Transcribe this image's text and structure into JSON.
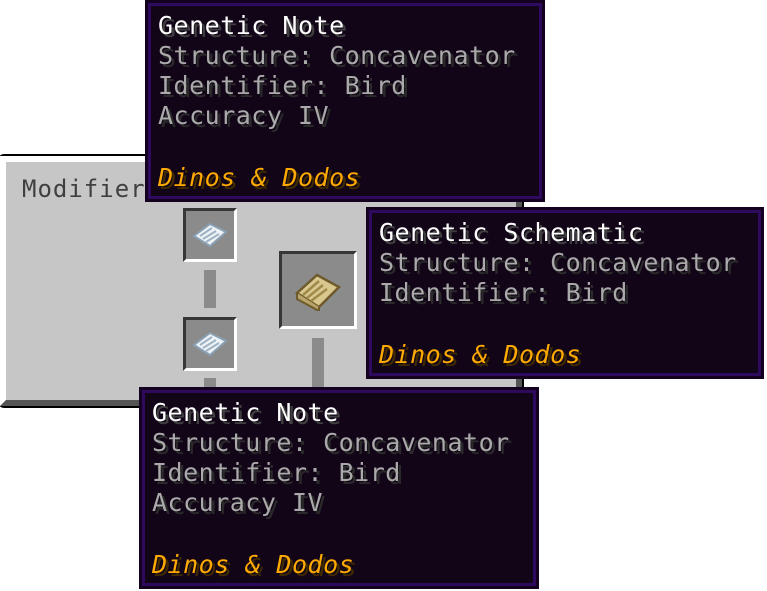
{
  "gui": {
    "title": "Modifier",
    "slots": [
      {
        "item_icon": "genetic-note-icon"
      },
      {
        "item_icon": "genetic-note-icon"
      },
      {
        "item_icon": "genetic-schematic-icon"
      }
    ]
  },
  "tooltips": [
    {
      "title": "Genetic Note",
      "lines": [
        "Structure: Concavenator",
        "Identifier: Bird",
        "Accuracy IV"
      ],
      "mod": "Dinos & Dodos"
    },
    {
      "title": "Genetic Schematic",
      "lines": [
        "Structure: Concavenator",
        "Identifier: Bird"
      ],
      "mod": "Dinos & Dodos"
    },
    {
      "title": "Genetic Note",
      "lines": [
        "Structure: Concavenator",
        "Identifier: Bird",
        "Accuracy IV"
      ],
      "mod": "Dinos & Dodos"
    }
  ],
  "colors": {
    "tooltip_bg": "#120518",
    "tooltip_border": "#2d0a5e",
    "mod_name": "#ffaa00",
    "lore_text": "#aaaaaa",
    "panel_bg": "#c6c6c6"
  }
}
